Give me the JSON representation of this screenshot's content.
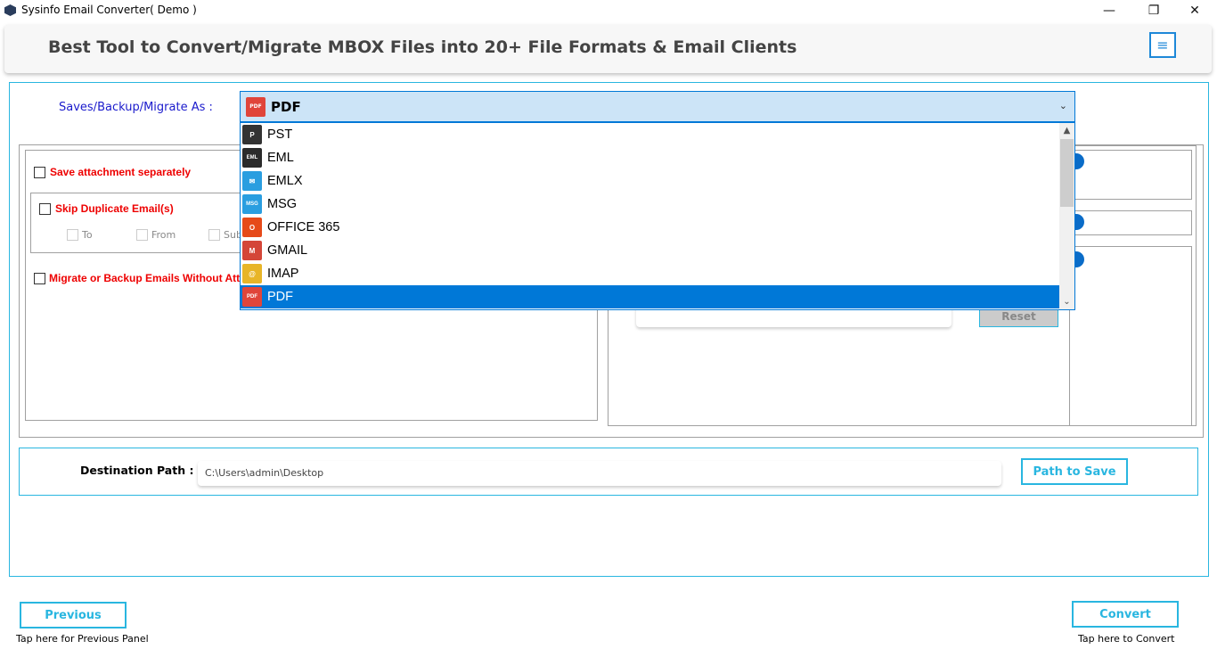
{
  "window": {
    "title": "Sysinfo Email Converter( Demo )",
    "app_icon": "sysinfo-logo-icon",
    "minimize": "—",
    "restore": "❐",
    "close": "✕"
  },
  "header": {
    "title": "Best Tool to Convert/Migrate MBOX Files into 20+ File Formats & Email Clients",
    "menu_icon": "≡"
  },
  "saveas": {
    "label": "Saves/Backup/Migrate As :",
    "selected": "PDF",
    "chevron": "⌄",
    "options": [
      {
        "label": "PST",
        "icon": "pst-icon",
        "badge": "P",
        "color": "#333333"
      },
      {
        "label": "EML",
        "icon": "eml-icon",
        "badge": "EML",
        "color": "#2b2b2b"
      },
      {
        "label": "EMLX",
        "icon": "emlx-icon",
        "badge": "✉",
        "color": "#2a9ee0"
      },
      {
        "label": "MSG",
        "icon": "msg-icon",
        "badge": "MSG",
        "color": "#2a9ee0"
      },
      {
        "label": "OFFICE 365",
        "icon": "office365-icon",
        "badge": "O",
        "color": "#e64a19"
      },
      {
        "label": "GMAIL",
        "icon": "gmail-icon",
        "badge": "M",
        "color": "#d44638"
      },
      {
        "label": "IMAP",
        "icon": "imap-icon",
        "badge": "@",
        "color": "#e8b528"
      },
      {
        "label": "PDF",
        "icon": "pdf-icon",
        "badge": "PDF",
        "color": "#e0453a"
      }
    ]
  },
  "options": {
    "save_attachment": "Save attachment separately",
    "skip_duplicate": "Skip Duplicate Email(s)",
    "dup_to": "To",
    "dup_from": "From",
    "dup_subject": "Sub",
    "migrate_without": "Migrate or Backup Emails Without Atta",
    "reset": "Reset"
  },
  "destination": {
    "label": "Destination Path :",
    "value": "C:\\Users\\admin\\Desktop",
    "button": "Path to Save"
  },
  "footer": {
    "previous": "Previous",
    "previous_hint": "Tap here for Previous Panel",
    "convert": "Convert",
    "convert_hint": "Tap here to Convert"
  }
}
